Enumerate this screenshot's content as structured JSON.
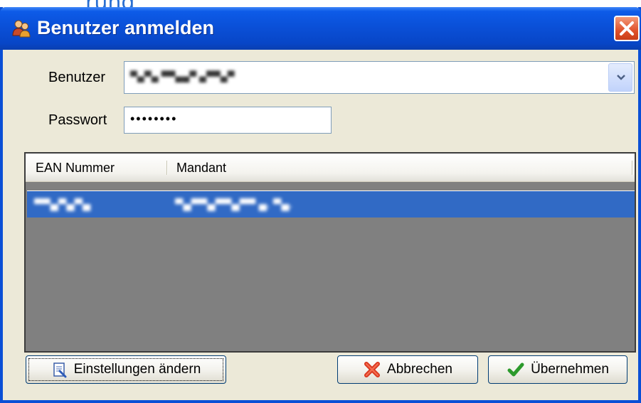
{
  "background": {
    "text": "rung"
  },
  "window": {
    "title": "Benutzer anmelden",
    "icon": "users-icon",
    "close_icon": "close-icon"
  },
  "form": {
    "user_label": "Benutzer",
    "user_value": "▀▄▀▄ ▀▀▄▄▀ ▄▀▀▄▀",
    "password_label": "Passwort",
    "password_value": "••••••••"
  },
  "table": {
    "columns": [
      "EAN Nummer",
      "Mandant"
    ],
    "rows": [
      {
        "ean": "▀▀▄▀▄▀▄",
        "mandant": "▀▄▀▀▄▀▀▄▀▀ ▄. ▀▄."
      }
    ]
  },
  "buttons": {
    "settings_label": "Einstellungen ändern",
    "cancel_label": "Abbrechen",
    "apply_label": "Übernehmen"
  },
  "colors": {
    "titlebar": "#0a50d8",
    "selection": "#316ac5",
    "list_bg": "#808080",
    "dialog_bg": "#ece9d8"
  }
}
